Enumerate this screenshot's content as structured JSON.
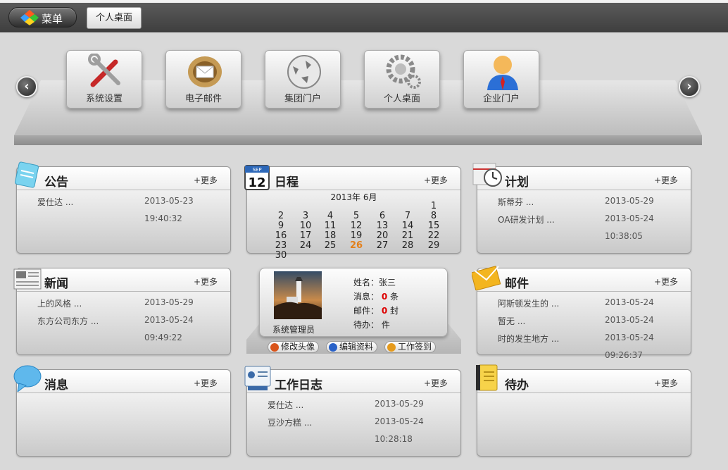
{
  "topbar": {
    "menu_label": "菜单",
    "tab_label": "个人桌面"
  },
  "apps": [
    {
      "label": "系统设置",
      "icon": "tools-icon"
    },
    {
      "label": "电子邮件",
      "icon": "mailbox-icon"
    },
    {
      "label": "集团门户",
      "icon": "globe-icon"
    },
    {
      "label": "个人桌面",
      "icon": "gears-icon"
    },
    {
      "label": "企业门户",
      "icon": "user-icon"
    }
  ],
  "more_label": "+更多",
  "announce": {
    "title": "公告",
    "rows": [
      {
        "name": "爱仕达 ...",
        "date": "2013-05-23",
        "time": "19:40:32"
      }
    ]
  },
  "schedule": {
    "title": "日程",
    "month_title": "2013年 6月",
    "days": [
      "1",
      "2",
      "3",
      "4",
      "5",
      "6",
      "7",
      "8",
      "9",
      "10",
      "11",
      "12",
      "13",
      "14",
      "15",
      "16",
      "17",
      "18",
      "19",
      "20",
      "21",
      "22",
      "23",
      "24",
      "25",
      "26",
      "27",
      "28",
      "29",
      "30"
    ],
    "today": "26",
    "icon_day": "12",
    "icon_month": "SEP"
  },
  "plan": {
    "title": "计划",
    "rows": [
      {
        "name": "斯蒂芬 ...",
        "date": "2013-05-29",
        "time": ""
      },
      {
        "name": "OA研发计划 ...",
        "date": "2013-05-24",
        "time": "10:38:05"
      }
    ]
  },
  "news": {
    "title": "新闻",
    "rows": [
      {
        "name": "上的风格 ...",
        "date": "2013-05-29",
        "time": ""
      },
      {
        "name": "东方公司东方 ...",
        "date": "2013-05-24",
        "time": "09:49:22"
      }
    ]
  },
  "profile": {
    "name_label": "姓名：",
    "name": "张三",
    "msg_label": "消息：",
    "msg_count": "0",
    "msg_unit": "条",
    "mail_label": "邮件：",
    "mail_count": "0",
    "mail_unit": "封",
    "todo_label": "待办：",
    "todo_unit": "件",
    "avatar_caption": "系统管理员",
    "buttons": [
      "修改头像",
      "编辑资料",
      "工作签到"
    ]
  },
  "mail": {
    "title": "邮件",
    "rows": [
      {
        "name": "阿斯顿发生的 ...",
        "date": "2013-05-24",
        "time": ""
      },
      {
        "name": "暂无 ...",
        "date": "2013-05-24",
        "time": ""
      },
      {
        "name": "时的发生地方 ...",
        "date": "2013-05-24",
        "time": "09:26:37"
      }
    ]
  },
  "message": {
    "title": "消息",
    "rows": []
  },
  "worklog": {
    "title": "工作日志",
    "rows": [
      {
        "name": "爱仕达 ...",
        "date": "2013-05-29",
        "time": ""
      },
      {
        "name": "豆沙方糕 ...",
        "date": "2013-05-24",
        "time": "10:28:18"
      }
    ]
  },
  "todo": {
    "title": "待办",
    "rows": []
  }
}
